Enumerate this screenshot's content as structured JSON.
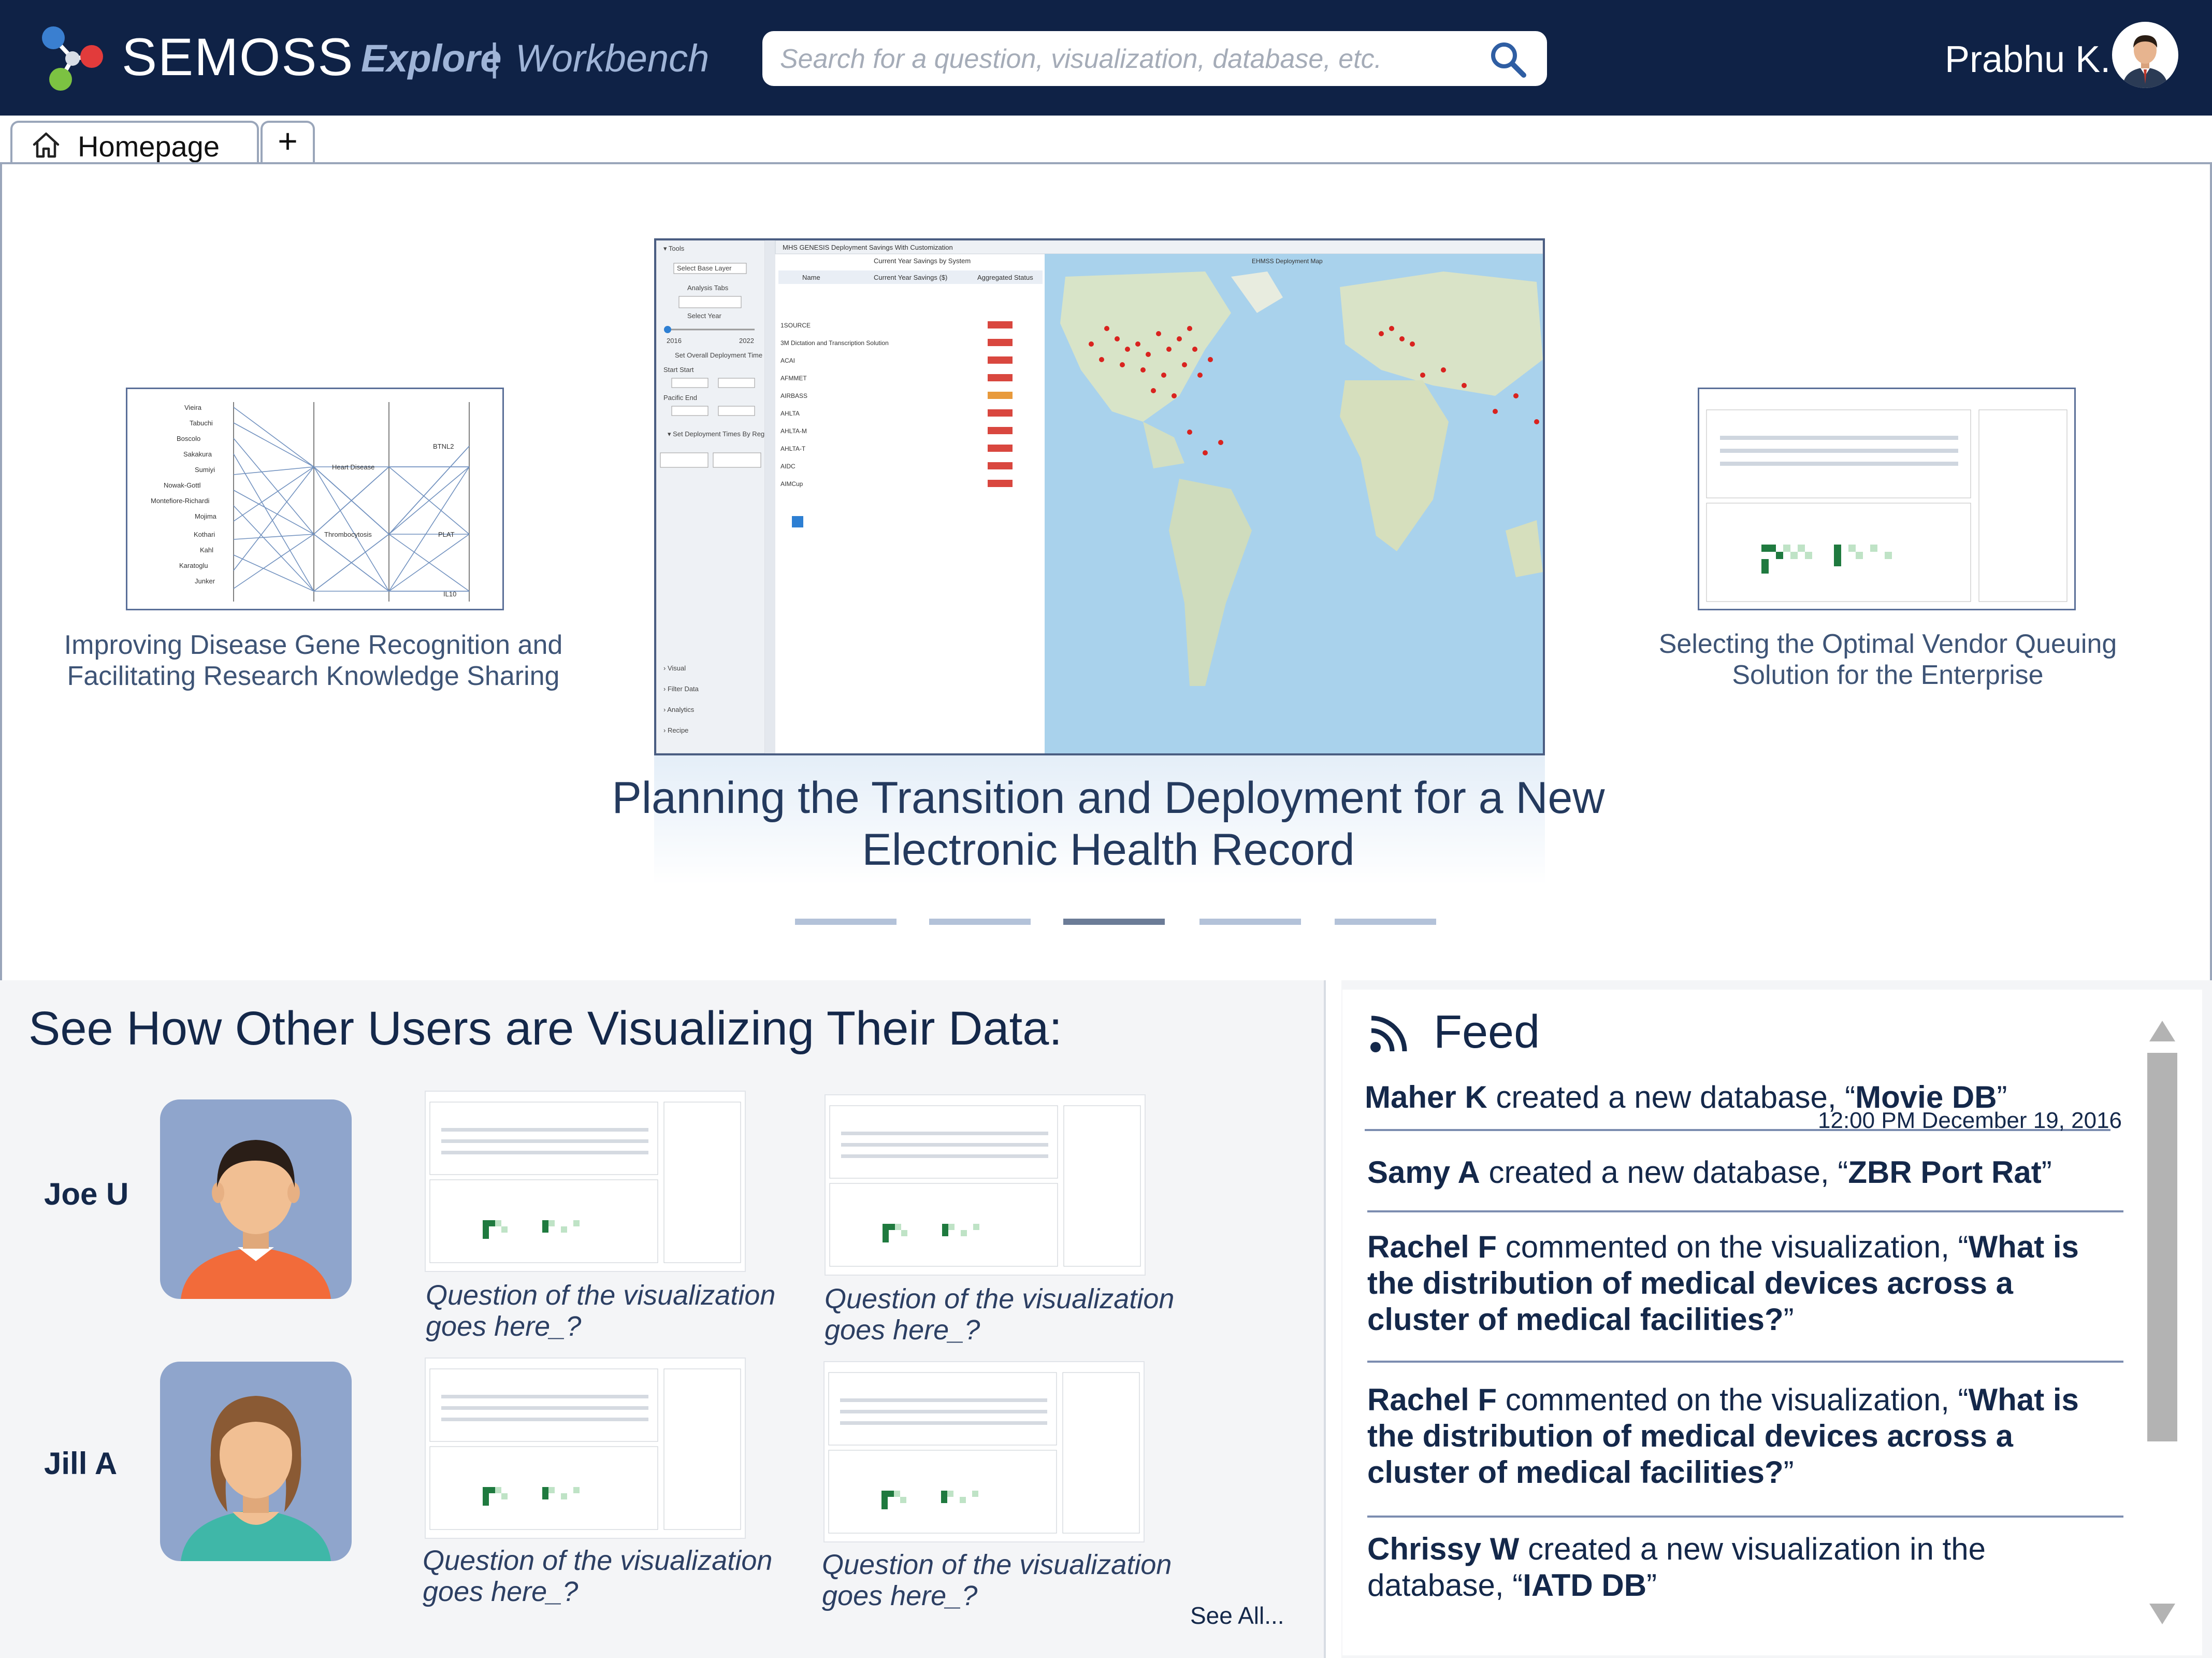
{
  "header": {
    "brand": "SEMOSS",
    "nav_explore": "Explore",
    "nav_separator": "|",
    "nav_workbench": "Workbench",
    "search_placeholder": "Search for a question, visualization, database, etc.",
    "user_name": "Prabhu K."
  },
  "tabs": {
    "home_label": "Homepage",
    "add_label": "+"
  },
  "carousel": {
    "left_title": "Improving Disease Gene Recognition and Facilitating Research Knowledge Sharing",
    "center_title": "Planning the Transition and Deployment for a New Electronic Health Record",
    "right_title": "Selecting the Optimal Vendor Queuing Solution for the Enterprise",
    "center_window_title": "MHS GENESIS Deployment Savings With Customization",
    "center_map_label": "EHMSS Deployment Map",
    "pages": 5,
    "active_page": 3
  },
  "users_section": {
    "heading": "See How Other Users are Visualizing Their Data:",
    "users": [
      {
        "name": "Joe U",
        "visualizations": [
          {
            "caption": "Question of the visualization goes here_?"
          },
          {
            "caption": "Question of the visualization goes here_?"
          }
        ]
      },
      {
        "name": "Jill A",
        "visualizations": [
          {
            "caption": "Question of the visualization goes here_?"
          },
          {
            "caption": "Question of the visualization goes here_?"
          }
        ]
      }
    ],
    "see_all": "See All..."
  },
  "feed": {
    "title": "Feed",
    "items": [
      {
        "actor": "Maher K",
        "action": " created a new database, “",
        "object": "Movie DB",
        "suffix": "”",
        "timestamp": "12:00 PM December 19, 2016"
      },
      {
        "actor": "Samy A",
        "action": " created a new database, “",
        "object": "ZBR Port Rat",
        "suffix": "”"
      },
      {
        "actor": "Rachel F",
        "action": " commented on the visualization, “",
        "object": "What is the distribution of medical devices across a cluster of medical facilities?",
        "suffix": "”"
      },
      {
        "actor": "Rachel F",
        "action": " commented on the visualization, “",
        "object": "What is the distribution of medical devices across a cluster of medical facilities?",
        "suffix": "”"
      },
      {
        "actor": "Chrissy W",
        "action": " created a new visualization in the database, “",
        "object": "IATD DB",
        "suffix": "”"
      }
    ]
  },
  "colors": {
    "header_bg": "#0f2246",
    "nav_text": "#9fb4d7",
    "heading_text": "#14284a",
    "avatar_bg": "#8fa5cc",
    "logo_blue": "#3a7fd0",
    "logo_red": "#e23b3b",
    "logo_green": "#7cc242"
  },
  "icons": [
    "logo-icon",
    "search-icon",
    "user-avatar-icon",
    "home-icon",
    "plus-icon",
    "rss-icon",
    "scroll-up-icon",
    "scroll-down-icon"
  ]
}
